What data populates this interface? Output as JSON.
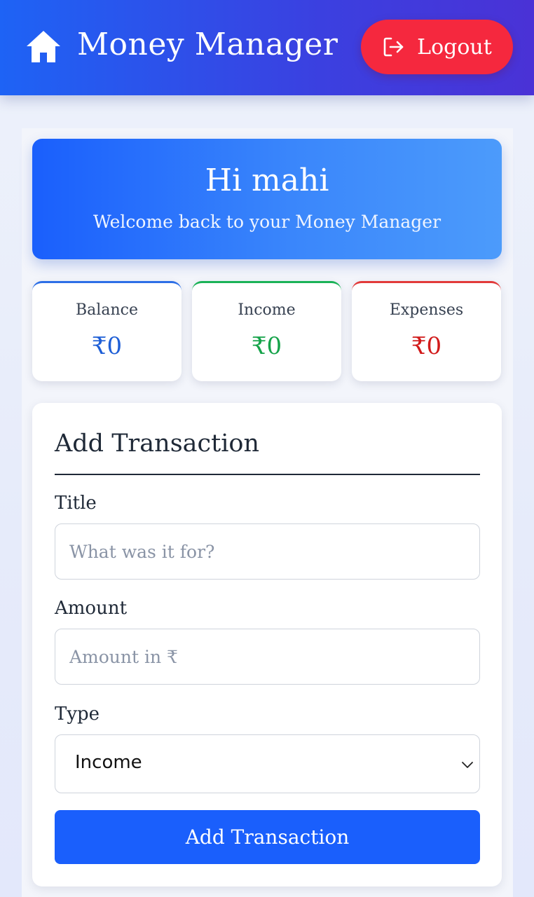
{
  "header": {
    "brand": "Money Manager",
    "home_icon": "home-icon",
    "logout_label": "Logout",
    "logout_icon": "logout-icon",
    "accent_from": "#1e63f5",
    "accent_to": "#4a32d6",
    "logout_color": "#f5283e"
  },
  "hero": {
    "greeting": "Hi mahi",
    "subtitle": "Welcome back to your Money Manager"
  },
  "stats": [
    {
      "label": "Balance",
      "value": "₹0",
      "color": "#1f5fd6"
    },
    {
      "label": "Income",
      "value": "₹0",
      "color": "#16a34a"
    },
    {
      "label": "Expenses",
      "value": "₹0",
      "color": "#d11a1a"
    }
  ],
  "form": {
    "title": "Add Transaction",
    "title_label": "Title",
    "title_placeholder": "What was it for?",
    "amount_label": "Amount",
    "amount_placeholder": "Amount in ₹",
    "type_label": "Type",
    "type_value": "Income",
    "submit_label": "Add Transaction",
    "submit_color": "#1a5ffc"
  }
}
